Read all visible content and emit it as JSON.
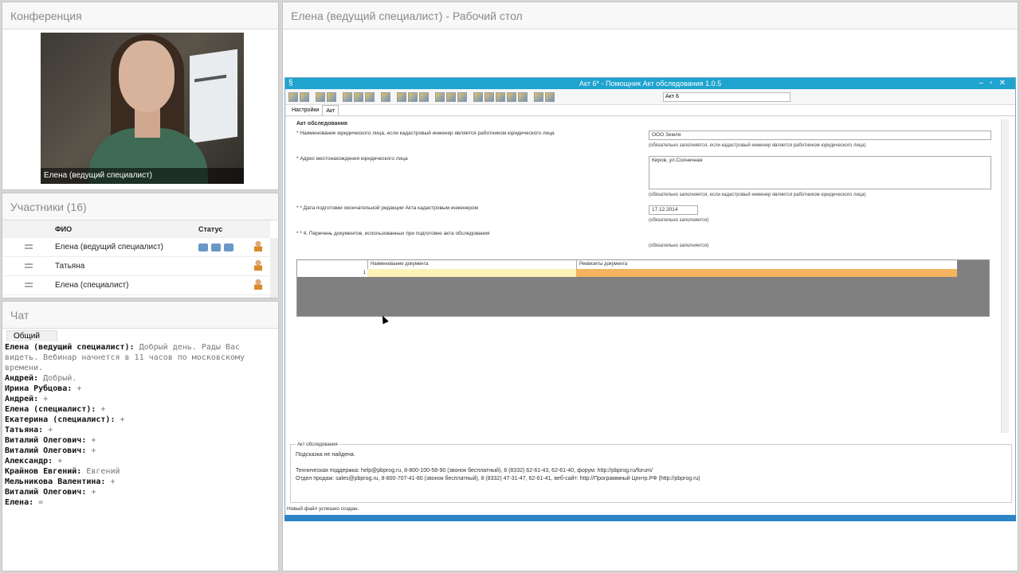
{
  "conference": {
    "title": "Конференция",
    "video_caption": "Елена (ведущий специалист)"
  },
  "participants": {
    "title": "Участники (16)",
    "col_name": "ФИО",
    "col_status": "Статус",
    "rows": [
      {
        "name": "Елена (ведущий специалист)"
      },
      {
        "name": "Татьяна"
      },
      {
        "name": "Елена (специалист)"
      }
    ]
  },
  "chat": {
    "title": "Чат",
    "tab": "Общий",
    "messages": [
      {
        "author": "Елена (ведущий специалист):",
        "text": " Добрый день. Рады Вас видеть. Вебинар начнется в 11 часов по московскому времени."
      },
      {
        "author": "Андрей:",
        "text": " Добрый."
      },
      {
        "author": "Ирина Рубцова:",
        "text": " +"
      },
      {
        "author": "Андрей:",
        "text": " +"
      },
      {
        "author": "Елена (специалист):",
        "text": " +"
      },
      {
        "author": "Екатерина (специалист):",
        "text": " +"
      },
      {
        "author": "Татьяна:",
        "text": " +"
      },
      {
        "author": "Виталий Олегович:",
        "text": " +"
      },
      {
        "author": "Виталий Олегович:",
        "text": " +"
      },
      {
        "author": "Александр:",
        "text": " +"
      },
      {
        "author": "Крайнов Евгений:",
        "text": " Евгений"
      },
      {
        "author": "Мельникова Валентина:",
        "text": " +"
      },
      {
        "author": "Виталий Олегович:",
        "text": " +"
      },
      {
        "author": "Елена:",
        "text": " ="
      }
    ]
  },
  "desktop": {
    "title": "Елена (ведущий специалист) - Рабочий стол",
    "window_title": "Акт 6* - Помощник Акт обследования 1.0.5",
    "toolbar_field": "Акт 6",
    "tabs": [
      "Настройки",
      "Акт"
    ],
    "section": "Акт обследования",
    "field1_label": "* Наименование юридического лица, если кадастровый инженер является работником юридического лица",
    "field1_value": "ООО Земля",
    "field1_note": "(обязательно заполняется, если кадастровый инженер является работником юридического лица)",
    "field2_label": "* Адрес местонахождения юридического лица",
    "field2_value": "Киров, ул.Солнечная",
    "field2_note": "(обязательно заполняется, если кадастровый инженер является работником юридического лица)",
    "field3_label": "* * Дата подготовки окончательной редакции Акта кадастровым инженером",
    "field3_value": "17.12.2014",
    "field3_note": "(обязательно заполняется)",
    "field4_label": "* * 4. Перечень документов, использованных при подготовке акта обследования",
    "field4_note": "(обязательно заполняется)",
    "grid_col1": "Наименование документа",
    "grid_col2": "Реквизиты документа",
    "grid_row_num": "1",
    "hint_legend": "Акт обследования",
    "hint_line1": "Подсказка не найдена.",
    "hint_line2": "Техническая поддержка: help@pbprog.ru, 8-800-100-58-90 (звонок бесплатный), 8 (8332) 62-61-43, 62-61-40, форум: http://pbprog.ru/forum/",
    "hint_line3": "Отдел продаж: sales@pbprog.ru, 8-800-707-41-80 (звонок бесплатный), 8 (8332) 47-31-47, 62-61-41, веб-сайт: http://Программный Центр.РФ (http://pbprog.ru)",
    "status": "Новый файл успешно создан."
  }
}
